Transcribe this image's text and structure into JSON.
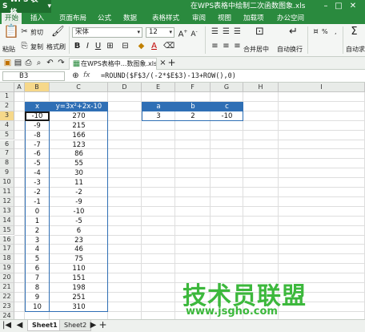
{
  "titlebar": {
    "app_label": "WPS 表格",
    "doc_title": "在WPS表格中绘制二次函数图象.xls"
  },
  "menu": {
    "items": [
      "开始",
      "插入",
      "页面布局",
      "公式",
      "数据",
      "表格样式",
      "审阅",
      "视图",
      "加载项",
      "办公空间"
    ],
    "active_index": 0
  },
  "ribbon": {
    "cut": "剪切",
    "paste": "粘贴",
    "copy": "复制",
    "format_painter": "格式刷",
    "font_name": "宋体",
    "font_size": "12",
    "merge_center": "合并居中",
    "wrap_text": "自动换行",
    "autosum": "自动求",
    "percent": "%",
    "comma": ","
  },
  "doc_tab": {
    "label": "在WPS表格中...数图象.xls"
  },
  "formula_bar": {
    "name_box": "B3",
    "fx": "fx",
    "formula": "=ROUND($F$3/(-2*$E$3)-13+ROW(),0)"
  },
  "columns": [
    "A",
    "B",
    "C",
    "D",
    "E",
    "F",
    "G",
    "H",
    "I"
  ],
  "rows": [
    "1",
    "2",
    "3",
    "4",
    "5",
    "6",
    "7",
    "8",
    "9",
    "10",
    "11",
    "12",
    "13",
    "14",
    "15",
    "16",
    "17",
    "18",
    "19",
    "20",
    "21",
    "22",
    "23",
    "24"
  ],
  "table_xy": {
    "headers": [
      "x",
      "y=3x²+2x-10"
    ],
    "rows": [
      [
        "-10",
        "270"
      ],
      [
        "-9",
        "215"
      ],
      [
        "-8",
        "166"
      ],
      [
        "-7",
        "123"
      ],
      [
        "-6",
        "86"
      ],
      [
        "-5",
        "55"
      ],
      [
        "-4",
        "30"
      ],
      [
        "-3",
        "11"
      ],
      [
        "-2",
        "-2"
      ],
      [
        "-1",
        "-9"
      ],
      [
        "0",
        "-10"
      ],
      [
        "1",
        "-5"
      ],
      [
        "2",
        "6"
      ],
      [
        "3",
        "23"
      ],
      [
        "4",
        "46"
      ],
      [
        "5",
        "75"
      ],
      [
        "6",
        "110"
      ],
      [
        "7",
        "151"
      ],
      [
        "8",
        "198"
      ],
      [
        "9",
        "251"
      ],
      [
        "10",
        "310"
      ]
    ]
  },
  "table_abc": {
    "headers": [
      "a",
      "b",
      "c"
    ],
    "values": [
      "3",
      "2",
      "-10"
    ]
  },
  "sheets": {
    "tabs": [
      "Sheet1",
      "Sheet2"
    ],
    "active_index": 0
  },
  "watermark": {
    "text": "技术员联盟",
    "url": "www.jsgho.com"
  },
  "colors": {
    "title_green": "#2a8a3e",
    "table_blue": "#2f6fb5",
    "watermark_green": "#3cb83c",
    "selection": "#f6d88a"
  }
}
